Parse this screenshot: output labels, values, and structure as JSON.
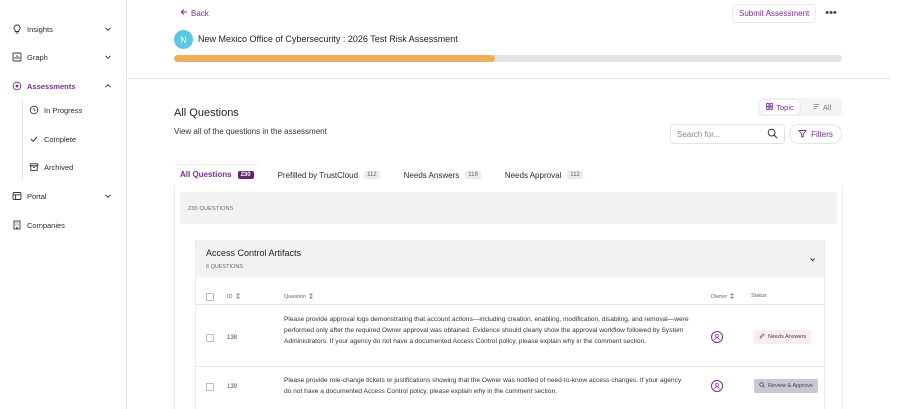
{
  "sidebar": {
    "items": [
      {
        "label": "Insights",
        "icon": "lightbulb-icon"
      },
      {
        "label": "Graph",
        "icon": "chart-icon"
      },
      {
        "label": "Assessments",
        "icon": "assessments-icon"
      },
      {
        "label": "Portal",
        "icon": "portal-icon"
      },
      {
        "label": "Companies",
        "icon": "building-icon"
      }
    ],
    "subitems": [
      {
        "label": "In Progress",
        "icon": "clock-icon"
      },
      {
        "label": "Complete",
        "icon": "check-icon"
      },
      {
        "label": "Archived",
        "icon": "archive-icon"
      }
    ]
  },
  "header": {
    "back_label": "Back",
    "submit_label": "Submit Assessment",
    "more_label": "•••",
    "avatar_letter": "N",
    "title": "New Mexico Office of Cybersecurity : 2026 Test Risk Assessment",
    "progress": 0.48
  },
  "section": {
    "title": "All Questions",
    "subtitle": "View all of the questions in the assessment"
  },
  "view_toggle": {
    "topic_label": "Topic",
    "all_label": "All"
  },
  "search": {
    "placeholder": "Search for..."
  },
  "filters_label": "Filters",
  "tabs": [
    {
      "label": "All Questions",
      "count": "230"
    },
    {
      "label": "Prefilled by TrustCloud",
      "count": "112"
    },
    {
      "label": "Needs Answers",
      "count": "118"
    },
    {
      "label": "Needs Approval",
      "count": "112"
    }
  ],
  "questions_count_label": "230 QUESTIONS",
  "group": {
    "title": "Access Control Artifacts",
    "subtitle": "6 QUESTIONS"
  },
  "table": {
    "columns": {
      "id": "ID",
      "question": "Question",
      "owner": "Owner",
      "status": "Status"
    },
    "rows": [
      {
        "id": "138",
        "question": "Please provide approval logs demonstrating that account actions—including creation, enabling, modification, disabling, and removal—were performed only after the required Owner approval was obtained. Evidence should clearly show the approval workflow followed by System Administrators. If your agency do not have a documented Access Control policy, please explain why in the comment section.",
        "status": "Needs Answers"
      },
      {
        "id": "139",
        "question": "Please provide role-change tickets or justifications showing that the Owner was notified of need-to-know access changes. If your agency do not have a documented Access Control policy, please explain why in the comment section.",
        "status": "Review & Approve"
      }
    ]
  }
}
